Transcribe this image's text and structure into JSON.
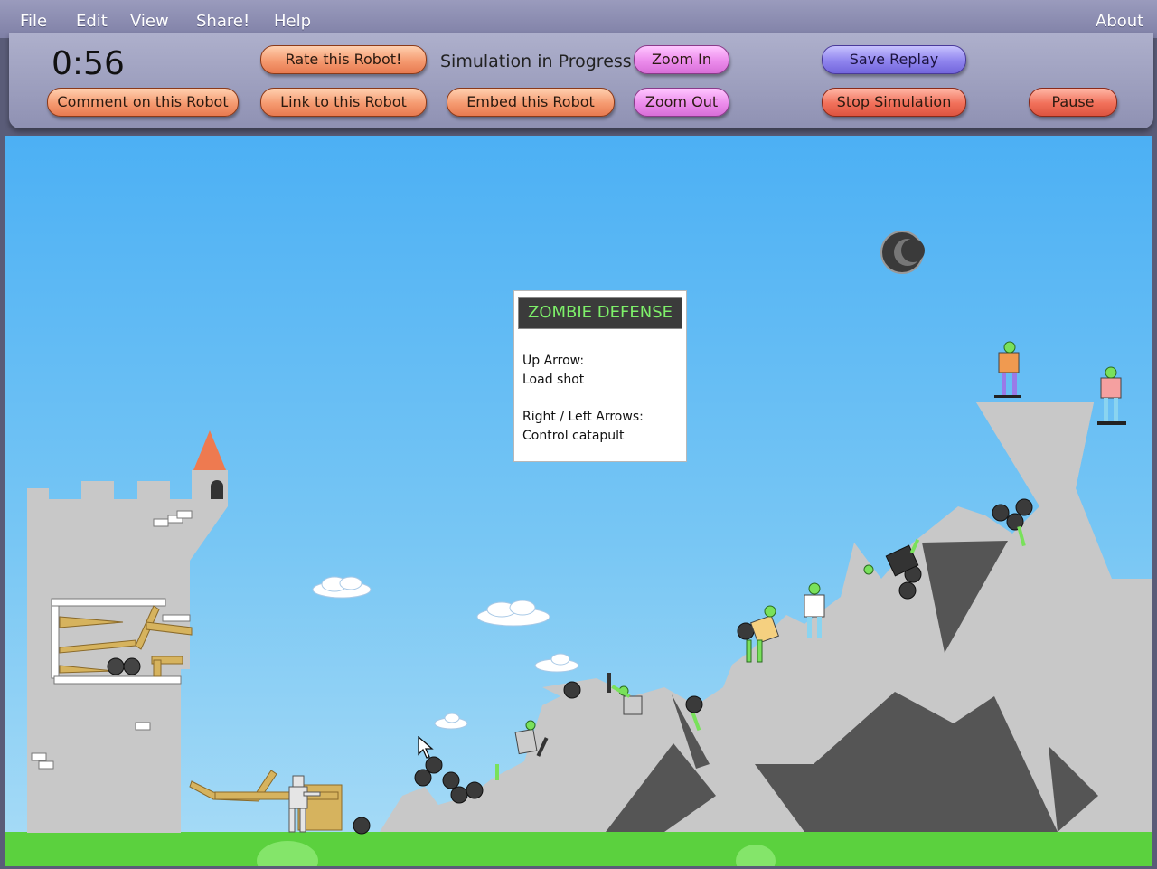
{
  "menu": {
    "file": "File",
    "edit": "Edit",
    "view": "View",
    "share": "Share!",
    "help": "Help",
    "about": "About"
  },
  "toolbar": {
    "timer": "0:56",
    "status": "Simulation in Progress",
    "rate": "Rate this Robot!",
    "comment": "Comment on this Robot",
    "link": "Link to this Robot",
    "embed": "Embed this Robot",
    "zoom_in": "Zoom In",
    "zoom_out": "Zoom Out",
    "save_replay": "Save Replay",
    "stop": "Stop Simulation",
    "pause": "Pause"
  },
  "info": {
    "title": "ZOMBIE DEFENSE",
    "line1": "Up Arrow:",
    "line2": "Load shot",
    "line3": "Right / Left Arrows:",
    "line4": "Control catapult"
  },
  "colors": {
    "title_text": "#7ef06a",
    "sky_top": "#4cb0f4",
    "ground": "#5bd13e",
    "rock": "#c8c8c8",
    "rock_dark": "#555555",
    "zombie_skin": "#79e15b"
  },
  "icons": {
    "moon": "crescent-moon-icon",
    "cursor": "mouse-pointer-icon"
  }
}
